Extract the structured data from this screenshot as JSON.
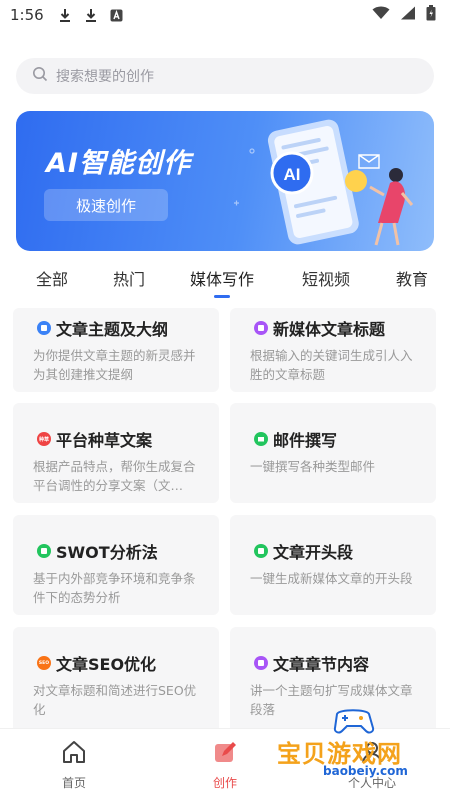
{
  "status_bar": {
    "time": "1:56"
  },
  "search": {
    "placeholder": "搜索想要的创作"
  },
  "banner": {
    "title": "AI智能创作",
    "button": "极速创作",
    "ai_badge": "AI"
  },
  "tabs": [
    {
      "label": "全部"
    },
    {
      "label": "热门"
    },
    {
      "label": "媒体写作",
      "active": true
    },
    {
      "label": "短视频"
    },
    {
      "label": "教育"
    }
  ],
  "cards": [
    {
      "title": "文章主题及大纲",
      "desc": "为你提供文章主题的新灵感并为其创建推文提纲",
      "badge_color": "#3b82f6"
    },
    {
      "title": "新媒体文章标题",
      "desc": "根据输入的关键词生成引人入胜的文章标题",
      "badge_color": "#a855f7"
    },
    {
      "title": "平台种草文案",
      "desc": "根据产品特点，帮你生成复合平台调性的分享文案（文…",
      "badge_color": "#ef4444",
      "badge_text": "种草"
    },
    {
      "title": "邮件撰写",
      "desc": "一键撰写各种类型邮件",
      "badge_color": "#22c55e"
    },
    {
      "title": "SWOT分析法",
      "desc": "基于内外部竞争环境和竞争条件下的态势分析",
      "badge_color": "#22c55e"
    },
    {
      "title": "文章开头段",
      "desc": "一键生成新媒体文章的开头段",
      "badge_color": "#22c55e"
    },
    {
      "title": "文章SEO优化",
      "desc": "对文章标题和简述进行SEO优化",
      "badge_color": "#f97316",
      "badge_text": "SEO"
    },
    {
      "title": "文章章节内容",
      "desc": "讲一个主题句扩写成媒体文章段落",
      "badge_color": "#a855f7"
    }
  ],
  "bottom_nav": [
    {
      "label": "首页",
      "icon": "home-icon"
    },
    {
      "label": "创作",
      "icon": "edit-icon",
      "active": true
    },
    {
      "label": "个人中心",
      "icon": "user-icon"
    }
  ],
  "watermark": {
    "text": "宝贝游戏网",
    "url": "baobeiy.com"
  },
  "colors": {
    "accent": "#2f6cf0",
    "active_nav": "#e94b4b"
  }
}
